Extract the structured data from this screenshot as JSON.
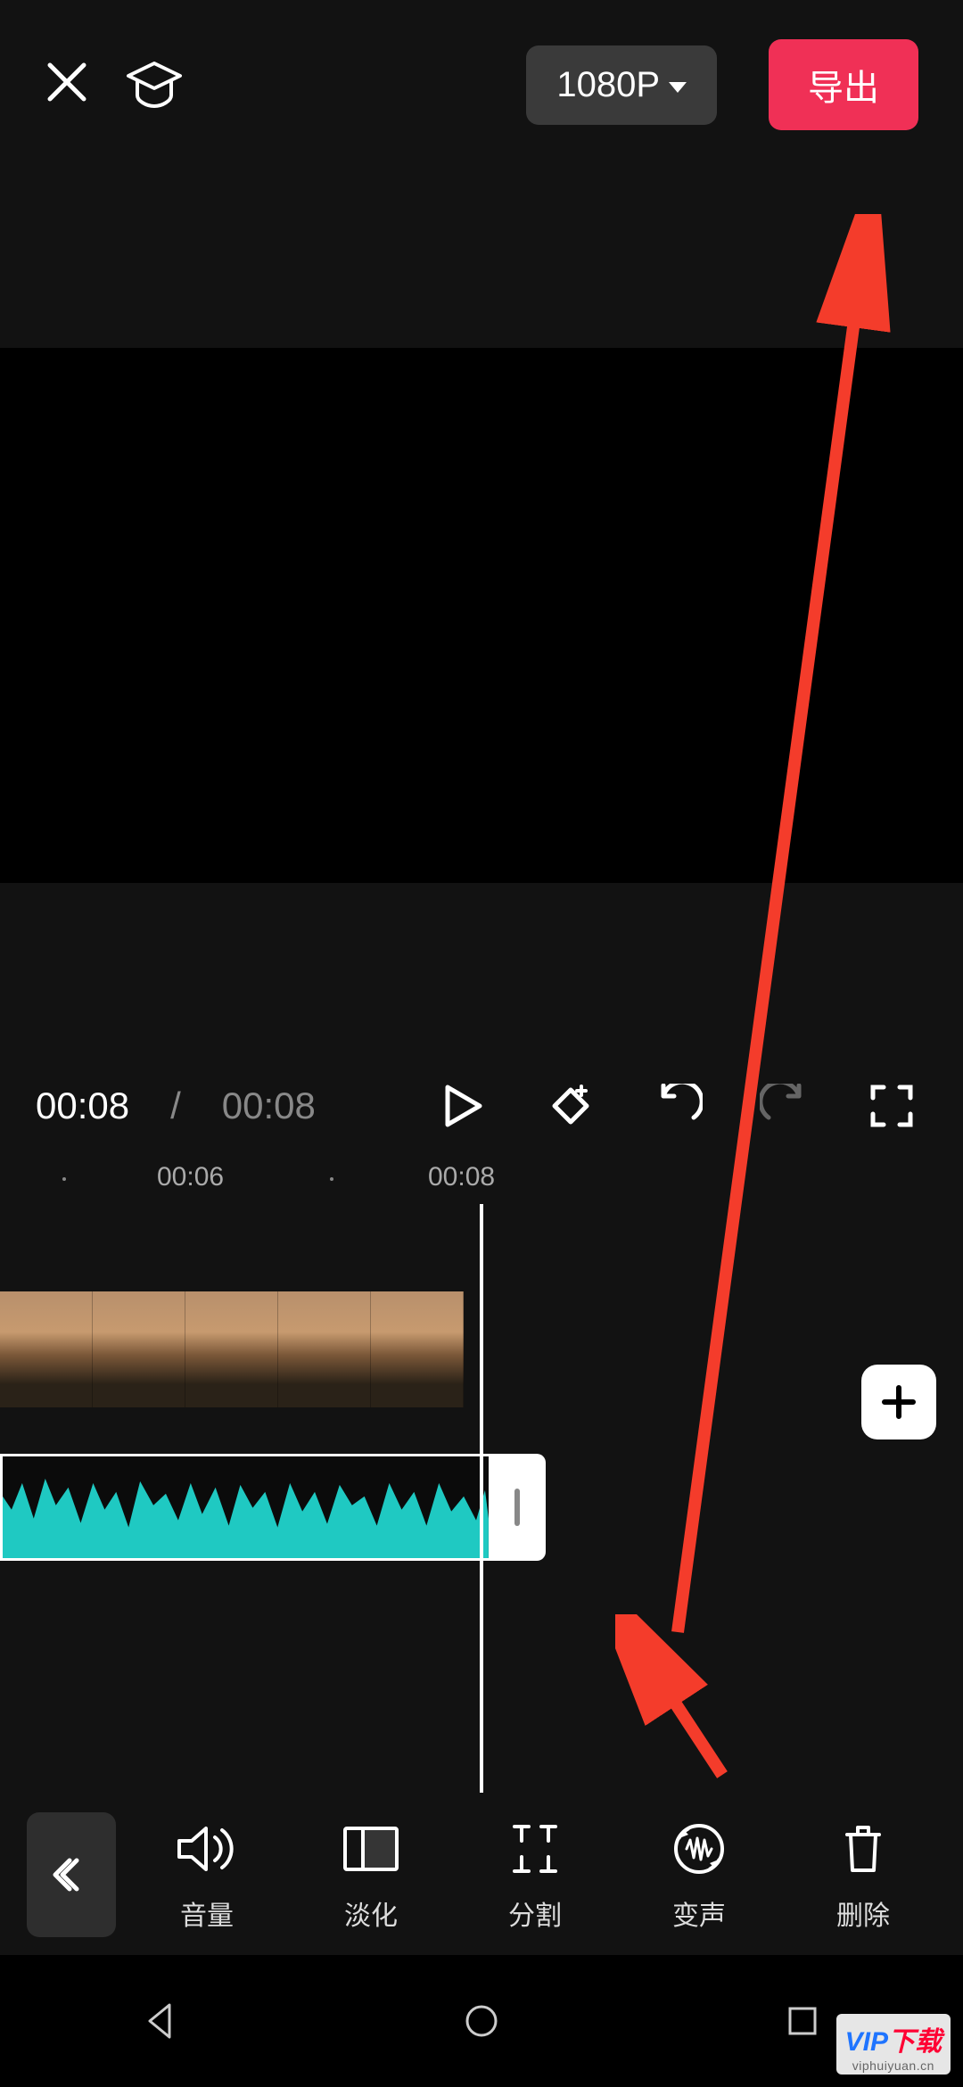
{
  "header": {
    "resolution_label": "1080P",
    "export_label": "导出"
  },
  "playback": {
    "current_time": "00:08",
    "total_time": "00:08"
  },
  "timeline": {
    "tick_labels": [
      "00:06",
      "00:08"
    ],
    "audio_color": "#1fc9c2"
  },
  "toolbar": {
    "items": [
      {
        "id": "volume",
        "label": "音量"
      },
      {
        "id": "fade",
        "label": "淡化"
      },
      {
        "id": "split",
        "label": "分割"
      },
      {
        "id": "voice-change",
        "label": "变声"
      },
      {
        "id": "delete",
        "label": "删除"
      }
    ]
  },
  "watermark": {
    "brand_part1": "VIP",
    "brand_part2": "下载",
    "url": "viphuiyuan.cn"
  }
}
